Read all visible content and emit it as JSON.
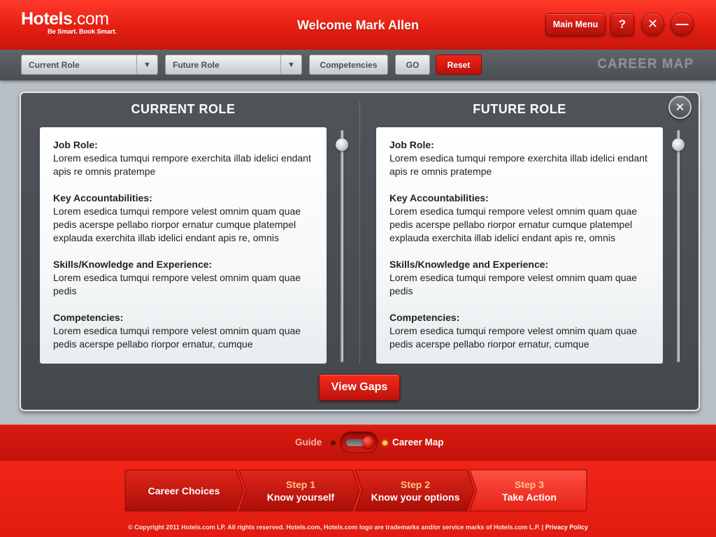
{
  "brand": {
    "logo_main": "Hotels",
    "logo_suffix": ".com",
    "tagline": "Be Smart. Book Smart."
  },
  "header": {
    "welcome": "Welcome Mark Allen",
    "main_menu": "Main Menu",
    "help": "?",
    "close": "✕",
    "minimize": "—"
  },
  "toolbar": {
    "current_role_select": "Current Role",
    "future_role_select": "Future Role",
    "competencies": "Competencies",
    "go": "GO",
    "reset": "Reset",
    "section_title": "CAREER MAP"
  },
  "panel": {
    "close": "✕",
    "current": {
      "title": "CURRENT ROLE",
      "sections": [
        {
          "title": "Job Role:",
          "body": "Lorem esedica tumqui rempore exerchita illab idelici endant apis re omnis pratempe"
        },
        {
          "title": "Key Accountabilities:",
          "body": "Lorem esedica tumqui rempore velest omnim quam quae pedis acerspe pellabo riorpor ernatur cumque platempel explauda exerchita illab idelici endant apis re, omnis"
        },
        {
          "title": "Skills/Knowledge and Experience:",
          "body": "Lorem esedica tumqui rempore velest omnim quam quae pedis"
        },
        {
          "title": "Competencies:",
          "body": "Lorem esedica tumqui rempore velest omnim quam quae pedis acerspe pellabo riorpor ernatur, cumque"
        }
      ]
    },
    "future": {
      "title": "FUTURE ROLE",
      "sections": [
        {
          "title": "Job Role:",
          "body": "Lorem esedica tumqui rempore exerchita illab idelici endant apis re omnis pratempe"
        },
        {
          "title": "Key Accountabilities:",
          "body": "Lorem esedica tumqui rempore velest omnim quam quae pedis acerspe pellabo riorpor ernatur cumque platempel explauda exerchita illab idelici endant apis re, omnis"
        },
        {
          "title": "Skills/Knowledge and Experience:",
          "body": "Lorem esedica tumqui rempore velest omnim quam quae pedis"
        },
        {
          "title": "Competencies:",
          "body": "Lorem esedica tumqui rempore velest omnim quam quae pedis acerspe pellabo riorpor ernatur, cumque"
        }
      ]
    },
    "view_gaps": "View Gaps"
  },
  "mode_toggle": {
    "left_label": "Guide",
    "right_label": "Career Map",
    "selected": "Career Map"
  },
  "steps": [
    {
      "number": "",
      "name": "Career Choices"
    },
    {
      "number": "Step 1",
      "name": "Know yourself"
    },
    {
      "number": "Step 2",
      "name": "Know your options"
    },
    {
      "number": "Step 3",
      "name": "Take Action"
    }
  ],
  "footer": {
    "copyright": "© Copyright 2011 Hotels.com LP.  All rights reserved. Hotels.com, Hotels.com logo are trademarks and/or service marks of Hotels.com L.P.  |",
    "privacy": "Privacy Policy"
  },
  "colors": {
    "brand_red": "#e41f12",
    "panel_gray": "#4a4f53",
    "step_number": "#ffc38a"
  }
}
